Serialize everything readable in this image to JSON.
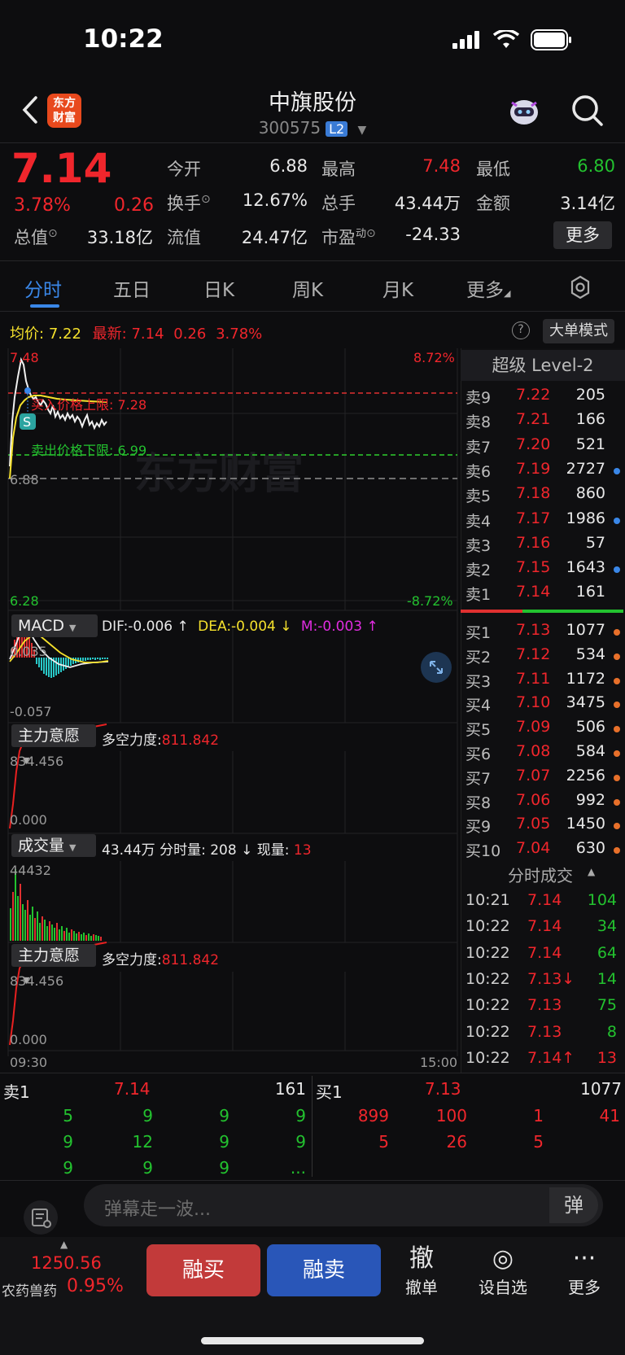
{
  "status": {
    "time": "10:22"
  },
  "header": {
    "logo_line1": "东方",
    "logo_line2": "财富",
    "stock_name": "中旗股份",
    "stock_code": "300575",
    "level_badge": "L2"
  },
  "quote": {
    "price": "7.14",
    "change_pct": "3.78%",
    "change_abs": "0.26",
    "fields": [
      {
        "label": "今开",
        "value": "6.88",
        "color": "white"
      },
      {
        "label": "最高",
        "value": "7.48",
        "color": "red"
      },
      {
        "label": "最低",
        "value": "6.80",
        "color": "green"
      },
      {
        "label": "换手",
        "value": "12.67%",
        "color": "white"
      },
      {
        "label": "总手",
        "value": "43.44万",
        "color": "white"
      },
      {
        "label": "金额",
        "value": "3.14亿",
        "color": "white"
      },
      {
        "label": "总值",
        "value": "33.18亿",
        "color": "white"
      },
      {
        "label": "流值",
        "value": "24.47亿",
        "color": "white"
      },
      {
        "label": "市盈",
        "label_sup": "动",
        "value": "-24.33",
        "color": "white"
      }
    ],
    "more_label": "更多"
  },
  "tabs": [
    "分时",
    "五日",
    "日K",
    "周K",
    "月K",
    "更多"
  ],
  "chart": {
    "avg_label": "均价:",
    "avg_value": "7.22",
    "latest_label": "最新:",
    "latest_value": "7.14",
    "latest_chg": "0.26",
    "latest_pct": "3.78%",
    "big_order_mode": "大单模式",
    "help_icon_text": "?",
    "y_top": "7.48",
    "y_top_pct": "8.72%",
    "y_bottom": "6.28",
    "y_bottom_pct": "-8.72%",
    "y_mid": "6.88",
    "upper_limit_label": "买入价格上限:",
    "upper_limit_value": "7.28",
    "lower_limit_label": "卖出价格下限:",
    "lower_limit_value": "6.99",
    "watermark": "东方财富",
    "marker_letter": "S",
    "time_start": "09:30",
    "time_end": "15:00"
  },
  "macd": {
    "name": "MACD",
    "dif": "DIF:-0.006 ↑",
    "dea": "DEA:-0.004 ↓",
    "m": "M:-0.003 ↑",
    "y_top": "0.035",
    "y_bottom": "-0.057"
  },
  "ind1": {
    "name": "主力意愿",
    "label": "多空力度:",
    "value": "811.842",
    "y_top": "834.456",
    "y_bottom": "0.000"
  },
  "volume": {
    "name": "成交量",
    "total": "43.44万",
    "minute_label": "分时量:",
    "minute_value": "208 ↓",
    "now_label": "现量:",
    "now_value": "13",
    "y_top": "44432"
  },
  "ind2": {
    "name": "主力意愿",
    "label": "多空力度:",
    "value": "811.842",
    "y_top": "834.456",
    "y_bottom": "0.000"
  },
  "orderbook": {
    "title": "超级 Level-2",
    "asks": [
      {
        "label": "卖9",
        "price": "7.22",
        "vol": "205",
        "dot": ""
      },
      {
        "label": "卖8",
        "price": "7.21",
        "vol": "166",
        "dot": ""
      },
      {
        "label": "卖7",
        "price": "7.20",
        "vol": "521",
        "dot": ""
      },
      {
        "label": "卖6",
        "price": "7.19",
        "vol": "2727",
        "dot": "#3a87e8"
      },
      {
        "label": "卖5",
        "price": "7.18",
        "vol": "860",
        "dot": ""
      },
      {
        "label": "卖4",
        "price": "7.17",
        "vol": "1986",
        "dot": "#3a87e8"
      },
      {
        "label": "卖3",
        "price": "7.16",
        "vol": "57",
        "dot": ""
      },
      {
        "label": "卖2",
        "price": "7.15",
        "vol": "1643",
        "dot": "#3a87e8"
      },
      {
        "label": "卖1",
        "price": "7.14",
        "vol": "161",
        "dot": ""
      }
    ],
    "bids": [
      {
        "label": "买1",
        "price": "7.13",
        "vol": "1077",
        "dot": "#e8702a"
      },
      {
        "label": "买2",
        "price": "7.12",
        "vol": "534",
        "dot": "#e8702a"
      },
      {
        "label": "买3",
        "price": "7.11",
        "vol": "1172",
        "dot": "#e8702a"
      },
      {
        "label": "买4",
        "price": "7.10",
        "vol": "3475",
        "dot": "#e8702a"
      },
      {
        "label": "买5",
        "price": "7.09",
        "vol": "506",
        "dot": "#e8702a"
      },
      {
        "label": "买6",
        "price": "7.08",
        "vol": "584",
        "dot": "#e8702a"
      },
      {
        "label": "买7",
        "price": "7.07",
        "vol": "2256",
        "dot": "#e8702a"
      },
      {
        "label": "买8",
        "price": "7.06",
        "vol": "992",
        "dot": "#e8702a"
      },
      {
        "label": "买9",
        "price": "7.05",
        "vol": "1450",
        "dot": "#e8702a"
      },
      {
        "label": "买10",
        "price": "7.04",
        "vol": "630",
        "dot": "#e8702a"
      }
    ]
  },
  "ticks": {
    "title": "分时成交",
    "rows": [
      {
        "time": "10:21",
        "price": "7.14",
        "vol": "104",
        "pcolor": "red",
        "vcolor": "green"
      },
      {
        "time": "10:22",
        "price": "7.14",
        "vol": "34",
        "pcolor": "red",
        "vcolor": "green"
      },
      {
        "time": "10:22",
        "price": "7.14",
        "vol": "64",
        "pcolor": "red",
        "vcolor": "green"
      },
      {
        "time": "10:22",
        "price": "7.13↓",
        "vol": "14",
        "pcolor": "red",
        "vcolor": "green"
      },
      {
        "time": "10:22",
        "price": "7.13",
        "vol": "75",
        "pcolor": "red",
        "vcolor": "green"
      },
      {
        "time": "10:22",
        "price": "7.13",
        "vol": "8",
        "pcolor": "red",
        "vcolor": "green"
      },
      {
        "time": "10:22",
        "price": "7.14↑",
        "vol": "13",
        "pcolor": "red",
        "vcolor": "red"
      }
    ]
  },
  "level1": {
    "ask_label": "卖1",
    "ask_price": "7.14",
    "ask_vol": "161",
    "bid_label": "买1",
    "bid_price": "7.13",
    "bid_vol": "1077",
    "ask_queue": [
      [
        "5",
        "9",
        "9",
        "9"
      ],
      [
        "9",
        "12",
        "9",
        "9"
      ],
      [
        "9",
        "9",
        "9",
        "..."
      ]
    ],
    "bid_queue": [
      [
        "899",
        "100",
        "1",
        "41"
      ],
      [
        "5",
        "26",
        "5",
        ""
      ]
    ]
  },
  "danmu": {
    "placeholder": "弹幕走一波...",
    "toggle": "弹"
  },
  "bottom": {
    "index_value": "1250.56",
    "index_name": "农药兽药",
    "index_chg": "0.95%",
    "buy": "融买",
    "sell": "融卖",
    "nav": [
      {
        "icon": "撤",
        "label": "撤单"
      },
      {
        "icon": "◎",
        "label": "设自选"
      },
      {
        "icon": "···",
        "label": "更多"
      }
    ]
  },
  "colors": {
    "up": "#f0262c",
    "down": "#23c22f",
    "avg": "#f5e12c",
    "accent": "#3a87e8"
  }
}
